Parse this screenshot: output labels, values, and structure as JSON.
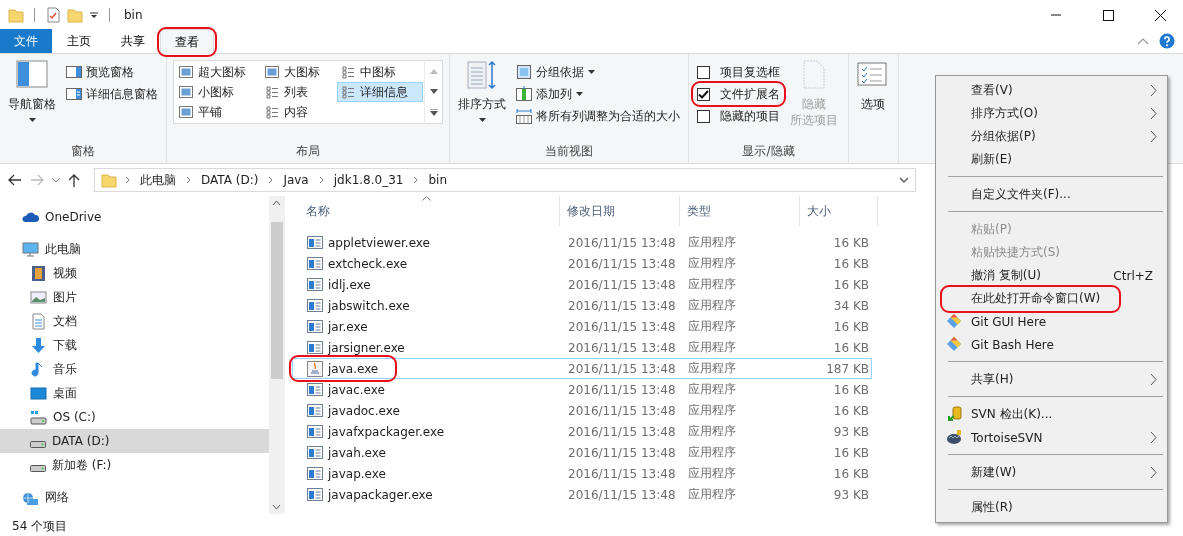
{
  "title_bar": {
    "title": "bin"
  },
  "ribbon_tabs": [
    {
      "label": "文件",
      "kind": "file",
      "selected": false,
      "highlighted": false
    },
    {
      "label": "主页",
      "kind": "tab",
      "selected": false,
      "highlighted": false
    },
    {
      "label": "共享",
      "kind": "tab",
      "selected": false,
      "highlighted": false
    },
    {
      "label": "查看",
      "kind": "tab",
      "selected": true,
      "highlighted": true
    }
  ],
  "ribbon_groups": [
    {
      "label": "窗格",
      "items": [
        {
          "kind": "large",
          "label": "导航窗格",
          "dropdown": true,
          "disabled": false
        },
        {
          "kind": "small",
          "label": "预览窗格",
          "dropdown": false
        },
        {
          "kind": "small",
          "label": "详细信息窗格",
          "dropdown": false
        }
      ]
    },
    {
      "label": "布局",
      "items": [
        {
          "kind": "gallery",
          "options": [
            {
              "label": "超大图标",
              "selected": false
            },
            {
              "label": "大图标",
              "selected": false
            },
            {
              "label": "中图标",
              "selected": false
            },
            {
              "label": "小图标",
              "selected": false
            },
            {
              "label": "列表",
              "selected": false
            },
            {
              "label": "详细信息",
              "selected": true
            },
            {
              "label": "平铺",
              "selected": false
            },
            {
              "label": "内容",
              "selected": false
            }
          ]
        }
      ]
    },
    {
      "label": "当前视图",
      "items": [
        {
          "kind": "large",
          "label": "排序方式",
          "dropdown": true,
          "disabled": false
        },
        {
          "kind": "small",
          "label": "分组依据",
          "dropdown": true
        },
        {
          "kind": "small",
          "label": "添加列",
          "dropdown": true
        },
        {
          "kind": "small",
          "label": "将所有列调整为合适的大小",
          "dropdown": false
        }
      ]
    },
    {
      "label": "显示/隐藏",
      "items": [
        {
          "kind": "checkbox",
          "label": "项目复选框",
          "checked": false,
          "highlighted": false
        },
        {
          "kind": "checkbox",
          "label": "文件扩展名",
          "checked": true,
          "highlighted": true
        },
        {
          "kind": "checkbox",
          "label": "隐藏的项目",
          "checked": false,
          "highlighted": false
        },
        {
          "kind": "large",
          "label_lines": [
            "隐藏",
            "所选项目"
          ],
          "dropdown": false,
          "disabled": true
        }
      ]
    },
    {
      "items": [
        {
          "kind": "large",
          "label": "选项",
          "dropdown": false,
          "disabled": false
        }
      ]
    }
  ],
  "address_bar": {
    "crumbs": [
      "此电脑",
      "DATA (D:)",
      "Java",
      "jdk1.8.0_31",
      "bin"
    ]
  },
  "navigation": [
    {
      "label": "OneDrive",
      "selected": false
    },
    {
      "label": "此电脑",
      "selected": false,
      "children": [
        {
          "label": "视频",
          "selected": false
        },
        {
          "label": "图片",
          "selected": false
        },
        {
          "label": "文档",
          "selected": false
        },
        {
          "label": "下载",
          "selected": false
        },
        {
          "label": "音乐",
          "selected": false
        },
        {
          "label": "桌面",
          "selected": false
        },
        {
          "label": "OS (C:)",
          "selected": false
        },
        {
          "label": "DATA (D:)",
          "selected": true
        },
        {
          "label": "新加卷 (F:)",
          "selected": false
        }
      ]
    },
    {
      "label": "网络",
      "selected": false
    }
  ],
  "table": {
    "columns": [
      {
        "label": "名称",
        "sorted": true
      },
      {
        "label": "修改日期",
        "sorted": false
      },
      {
        "label": "类型",
        "sorted": false
      },
      {
        "label": "大小",
        "sorted": false
      }
    ],
    "rows": [
      {
        "name": "appletviewer.exe",
        "date": "2016/11/15 13:48",
        "type": "应用程序",
        "size": "16 KB",
        "selected": false,
        "highlighted": false
      },
      {
        "name": "extcheck.exe",
        "date": "2016/11/15 13:48",
        "type": "应用程序",
        "size": "16 KB",
        "selected": false,
        "highlighted": false
      },
      {
        "name": "idlj.exe",
        "date": "2016/11/15 13:48",
        "type": "应用程序",
        "size": "16 KB",
        "selected": false,
        "highlighted": false
      },
      {
        "name": "jabswitch.exe",
        "date": "2016/11/15 13:48",
        "type": "应用程序",
        "size": "34 KB",
        "selected": false,
        "highlighted": false
      },
      {
        "name": "jar.exe",
        "date": "2016/11/15 13:48",
        "type": "应用程序",
        "size": "16 KB",
        "selected": false,
        "highlighted": false
      },
      {
        "name": "jarsigner.exe",
        "date": "2016/11/15 13:48",
        "type": "应用程序",
        "size": "16 KB",
        "selected": false,
        "highlighted": false
      },
      {
        "name": "java.exe",
        "date": "2016/11/15 13:48",
        "type": "应用程序",
        "size": "187 KB",
        "selected": true,
        "highlighted": true
      },
      {
        "name": "javac.exe",
        "date": "2016/11/15 13:48",
        "type": "应用程序",
        "size": "16 KB",
        "selected": false,
        "highlighted": false
      },
      {
        "name": "javadoc.exe",
        "date": "2016/11/15 13:48",
        "type": "应用程序",
        "size": "16 KB",
        "selected": false,
        "highlighted": false
      },
      {
        "name": "javafxpackager.exe",
        "date": "2016/11/15 13:48",
        "type": "应用程序",
        "size": "93 KB",
        "selected": false,
        "highlighted": false
      },
      {
        "name": "javah.exe",
        "date": "2016/11/15 13:48",
        "type": "应用程序",
        "size": "16 KB",
        "selected": false,
        "highlighted": false
      },
      {
        "name": "javap.exe",
        "date": "2016/11/15 13:48",
        "type": "应用程序",
        "size": "16 KB",
        "selected": false,
        "highlighted": false
      },
      {
        "name": "javapackager.exe",
        "date": "2016/11/15 13:48",
        "type": "应用程序",
        "size": "93 KB",
        "selected": false,
        "highlighted": false
      }
    ]
  },
  "context_menu": [
    {
      "kind": "item",
      "label": "查看(V)",
      "submenu": true,
      "disabled": false
    },
    {
      "kind": "item",
      "label": "排序方式(O)",
      "submenu": true,
      "disabled": false
    },
    {
      "kind": "item",
      "label": "分组依据(P)",
      "submenu": true,
      "disabled": false
    },
    {
      "kind": "item",
      "label": "刷新(E)",
      "submenu": false,
      "disabled": false
    },
    {
      "kind": "separator"
    },
    {
      "kind": "item",
      "label": "自定义文件夹(F)...",
      "submenu": false,
      "disabled": false
    },
    {
      "kind": "separator"
    },
    {
      "kind": "item",
      "label": "粘贴(P)",
      "submenu": false,
      "disabled": true
    },
    {
      "kind": "item",
      "label": "粘贴快捷方式(S)",
      "submenu": false,
      "disabled": true
    },
    {
      "kind": "item",
      "label": "撤消 复制(U)",
      "shortcut": "Ctrl+Z",
      "submenu": false,
      "disabled": false
    },
    {
      "kind": "item",
      "label": "在此处打开命令窗口(W)",
      "submenu": false,
      "disabled": false,
      "highlighted": true
    },
    {
      "kind": "item",
      "label": "Git GUI Here",
      "submenu": false,
      "disabled": false
    },
    {
      "kind": "item",
      "label": "Git Bash Here",
      "submenu": false,
      "disabled": false
    },
    {
      "kind": "separator"
    },
    {
      "kind": "item",
      "label": "共享(H)",
      "submenu": true,
      "disabled": false
    },
    {
      "kind": "separator"
    },
    {
      "kind": "item",
      "label": "SVN 检出(K)...",
      "submenu": false,
      "disabled": false
    },
    {
      "kind": "item",
      "label": "TortoiseSVN",
      "submenu": true,
      "disabled": false
    },
    {
      "kind": "separator"
    },
    {
      "kind": "item",
      "label": "新建(W)",
      "submenu": true,
      "disabled": false
    },
    {
      "kind": "separator"
    },
    {
      "kind": "item",
      "label": "属性(R)",
      "submenu": false,
      "disabled": false
    }
  ],
  "status_bar": {
    "item_count": "54 个项目"
  }
}
